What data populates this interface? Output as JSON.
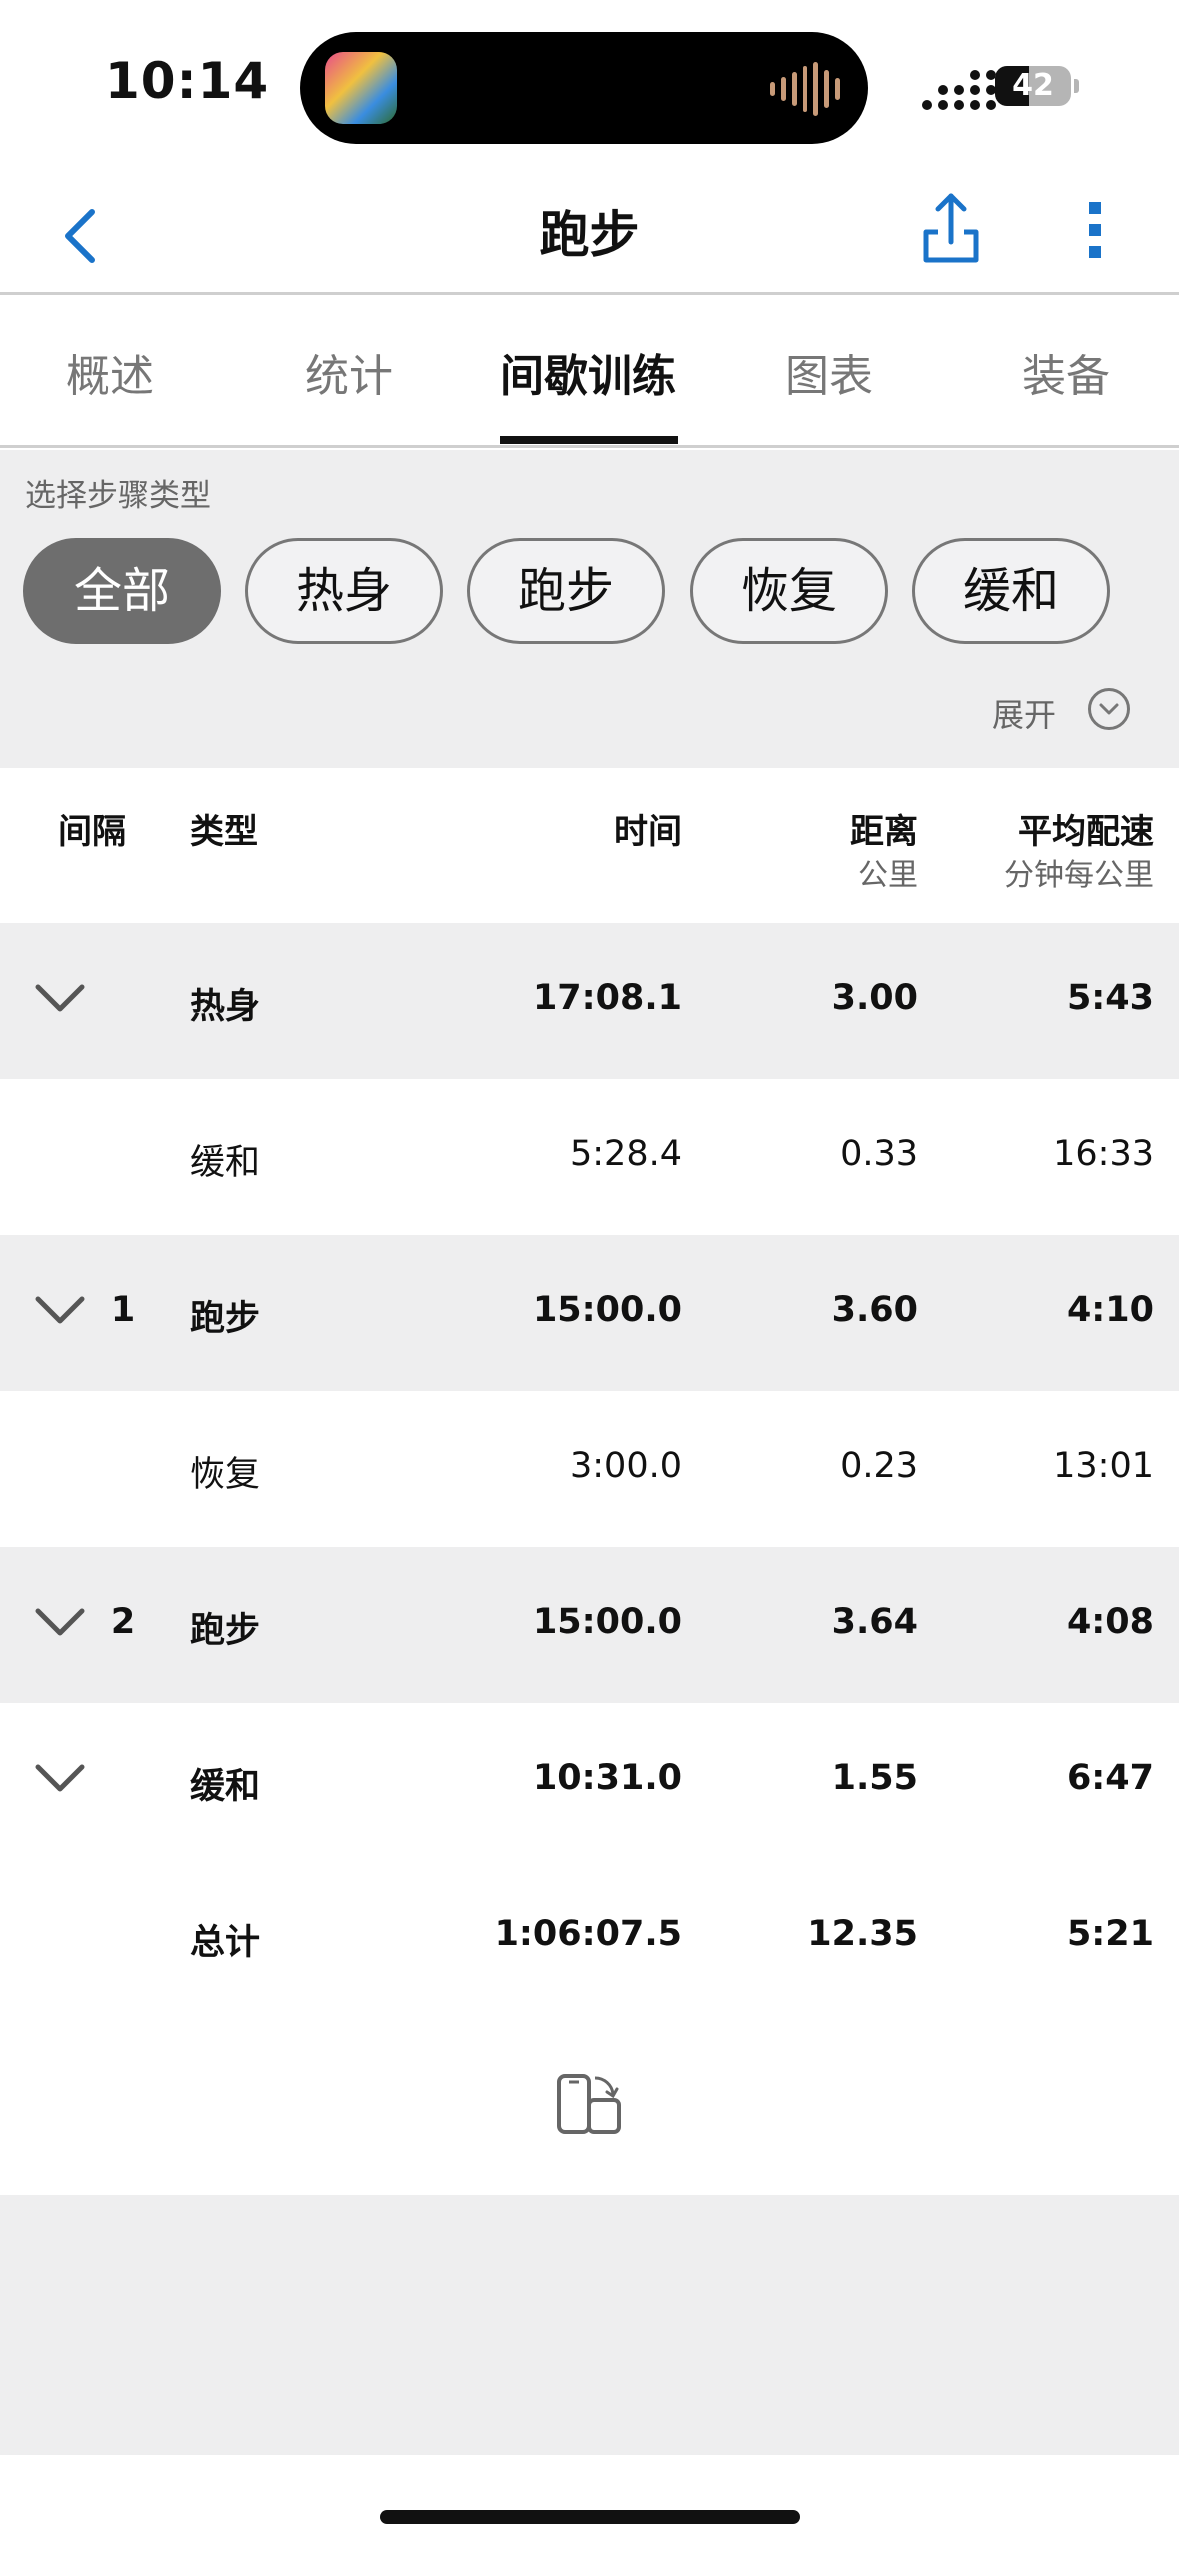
{
  "status_bar": {
    "time": "10:14",
    "battery": "42"
  },
  "nav": {
    "title": "跑步"
  },
  "tabs": [
    {
      "label": "概述",
      "active": false
    },
    {
      "label": "统计",
      "active": false
    },
    {
      "label": "间歇训练",
      "active": true
    },
    {
      "label": "图表",
      "active": false
    },
    {
      "label": "装备",
      "active": false
    }
  ],
  "filter": {
    "label": "选择步骤类型",
    "chips": [
      "全部",
      "热身",
      "跑步",
      "恢复",
      "缓和"
    ],
    "active_chip": "全部",
    "expand_label": "展开"
  },
  "table": {
    "headers": {
      "interval": "间隔",
      "type": "类型",
      "time": "时间",
      "distance": "距离",
      "distance_unit": "公里",
      "pace": "平均配速",
      "pace_unit": "分钟每公里"
    },
    "rows": [
      {
        "index": "",
        "type": "热身",
        "time": "17:08.1",
        "distance": "3.00",
        "pace": "5:43"
      },
      {
        "index": "",
        "type": "缓和",
        "time": "5:28.4",
        "distance": "0.33",
        "pace": "16:33"
      },
      {
        "index": "1",
        "type": "跑步",
        "time": "15:00.0",
        "distance": "3.60",
        "pace": "4:10"
      },
      {
        "index": "",
        "type": "恢复",
        "time": "3:00.0",
        "distance": "0.23",
        "pace": "13:01"
      },
      {
        "index": "2",
        "type": "跑步",
        "time": "15:00.0",
        "distance": "3.64",
        "pace": "4:08"
      },
      {
        "index": "",
        "type": "缓和",
        "time": "10:31.0",
        "distance": "1.55",
        "pace": "6:47"
      }
    ],
    "total": {
      "type": "总计",
      "time": "1:06:07.5",
      "distance": "12.35",
      "pace": "5:21"
    }
  },
  "colors": {
    "accent": "#1a73c9",
    "row_gray": "#eeeeef",
    "active_chip": "#6e6e6e"
  }
}
